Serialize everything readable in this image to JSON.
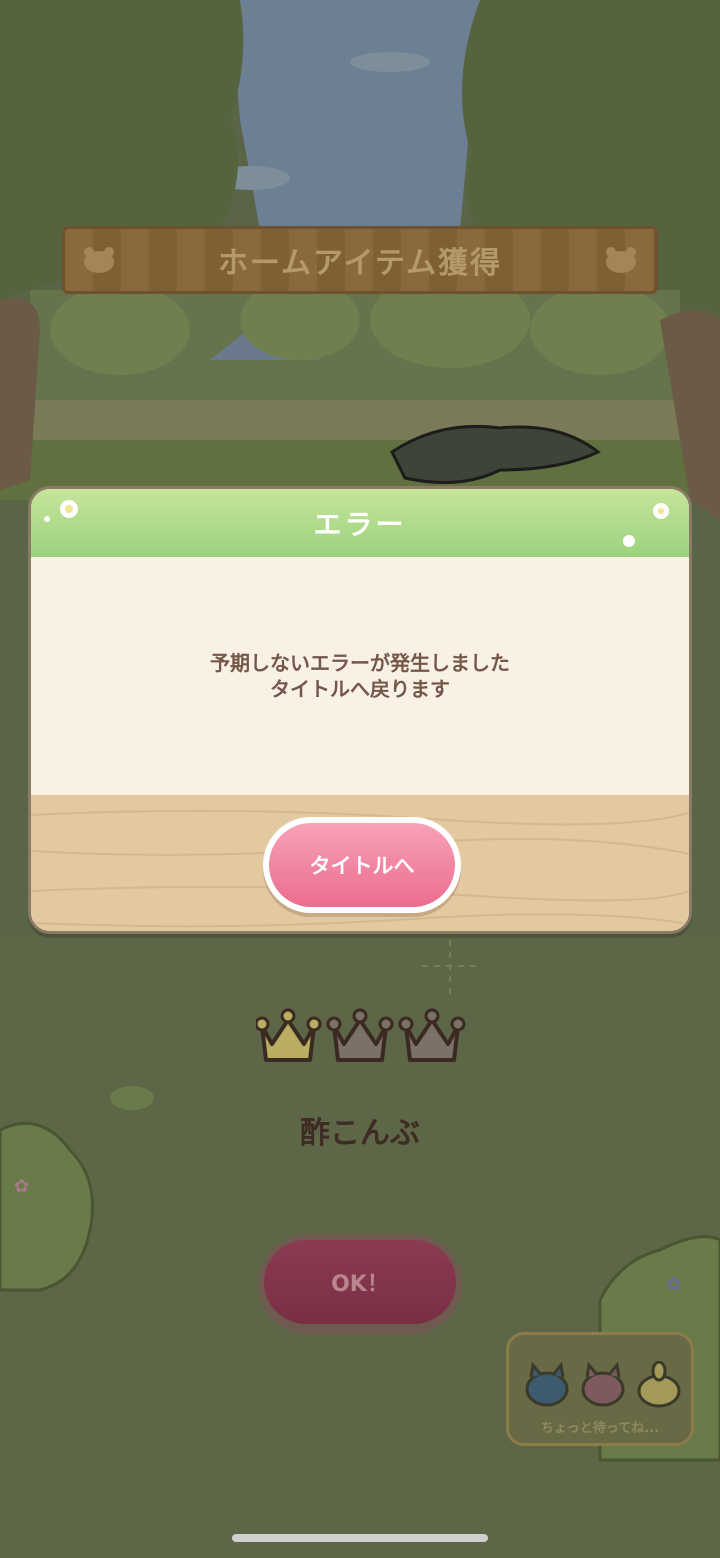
{
  "banner": {
    "title": "ホームアイテム獲得"
  },
  "dialog": {
    "title": "エラー",
    "message_line1": "予期しないエラーが発生しました",
    "message_line2": "タイトルへ戻ります",
    "button_label": "タイトルへ"
  },
  "reward": {
    "item_name": "酢こんぶ",
    "crowns_total": 3,
    "crowns_earned": 1,
    "ok_label": "OK！"
  },
  "waiting": {
    "text": "ちょっと待ってね..."
  },
  "colors": {
    "header_green": "#9bd27e",
    "button_pink": "#ec6c8e",
    "message_brown": "#74574a",
    "wood": "#e3c9a0"
  }
}
